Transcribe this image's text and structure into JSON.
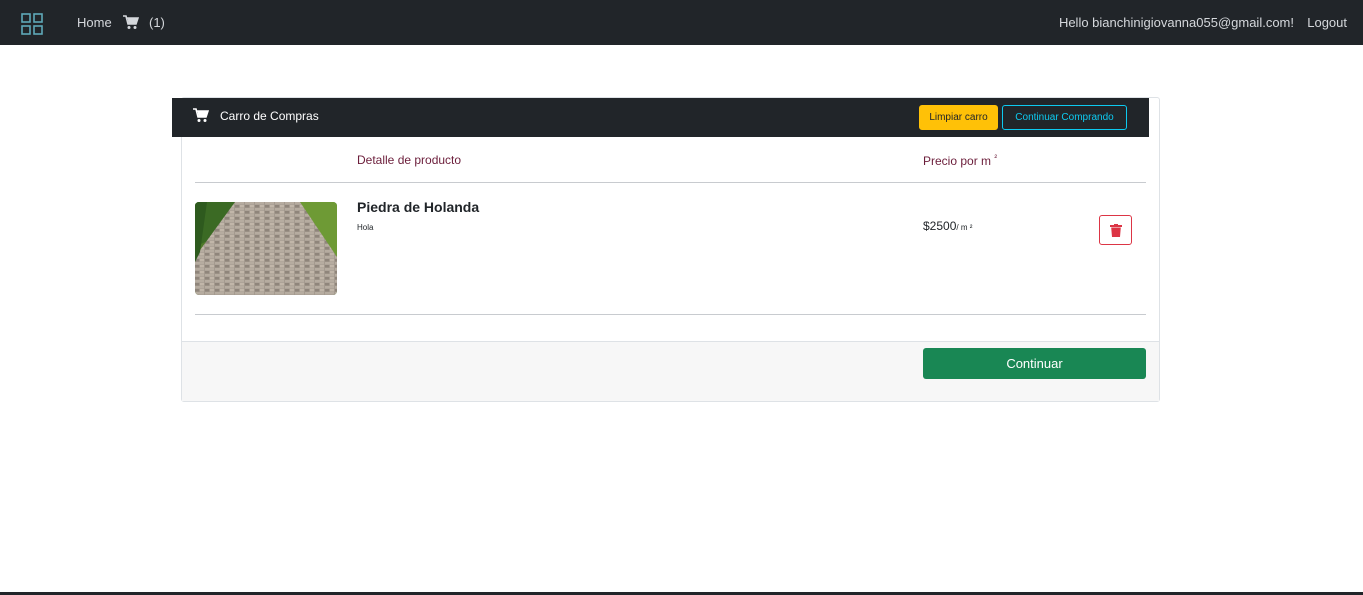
{
  "navbar": {
    "logo_icon": "grid-icon",
    "home_label": "Home",
    "cart_icon": "cart-icon",
    "cart_count": "(1)",
    "user_greeting": "Hello bianchinigiovanna055@gmail.com!",
    "logout_label": "Logout"
  },
  "cart": {
    "title": "Carro de Compras",
    "clear_label": "Limpiar carro",
    "continue_shopping_label": "Continuar Comprando",
    "col_detail": "Detalle de producto",
    "col_price": "Precio por m",
    "col_price_sup": "²",
    "items": [
      {
        "name": "Piedra de Holanda",
        "description": "Hola",
        "price": "$2500",
        "unit": "/ m ²",
        "image_icon": "paved-path-image",
        "delete_icon": "trash-icon"
      }
    ],
    "continue_label": "Continuar"
  },
  "colors": {
    "navbar_bg": "#212529",
    "warning": "#ffc107",
    "info": "#0dcaf0",
    "danger": "#dc3545",
    "success": "#198754",
    "header_text": "#6b1d3a"
  }
}
